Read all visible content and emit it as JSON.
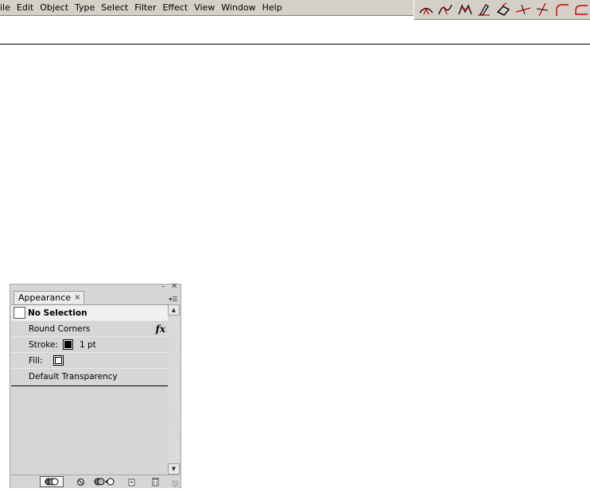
{
  "menubar": {
    "items": [
      "ile",
      "Edit",
      "Object",
      "Type",
      "Select",
      "Filter",
      "Effect",
      "View",
      "Window",
      "Help"
    ]
  },
  "toolbar": {
    "tools": [
      {
        "icon": "anchor-convert-icon"
      },
      {
        "icon": "anchor-smooth-icon"
      },
      {
        "icon": "anchor-corner-icon"
      },
      {
        "icon": "pen-delete-anchor-icon"
      },
      {
        "icon": "eraser-icon"
      },
      {
        "icon": "cut-path-icon"
      },
      {
        "icon": "knife-icon"
      },
      {
        "icon": "round-corner-icon"
      },
      {
        "icon": "round-join-icon"
      }
    ],
    "accent": "#cc0000"
  },
  "appearance_panel": {
    "tab_label": "Appearance",
    "close_glyph": "×",
    "header": "No Selection",
    "rows": {
      "effect": "Round Corners",
      "stroke_label": "Stroke:",
      "stroke_value": "1 pt",
      "fill_label": "Fill:",
      "transparency": "Default Transparency"
    },
    "fx_label": "fx"
  }
}
